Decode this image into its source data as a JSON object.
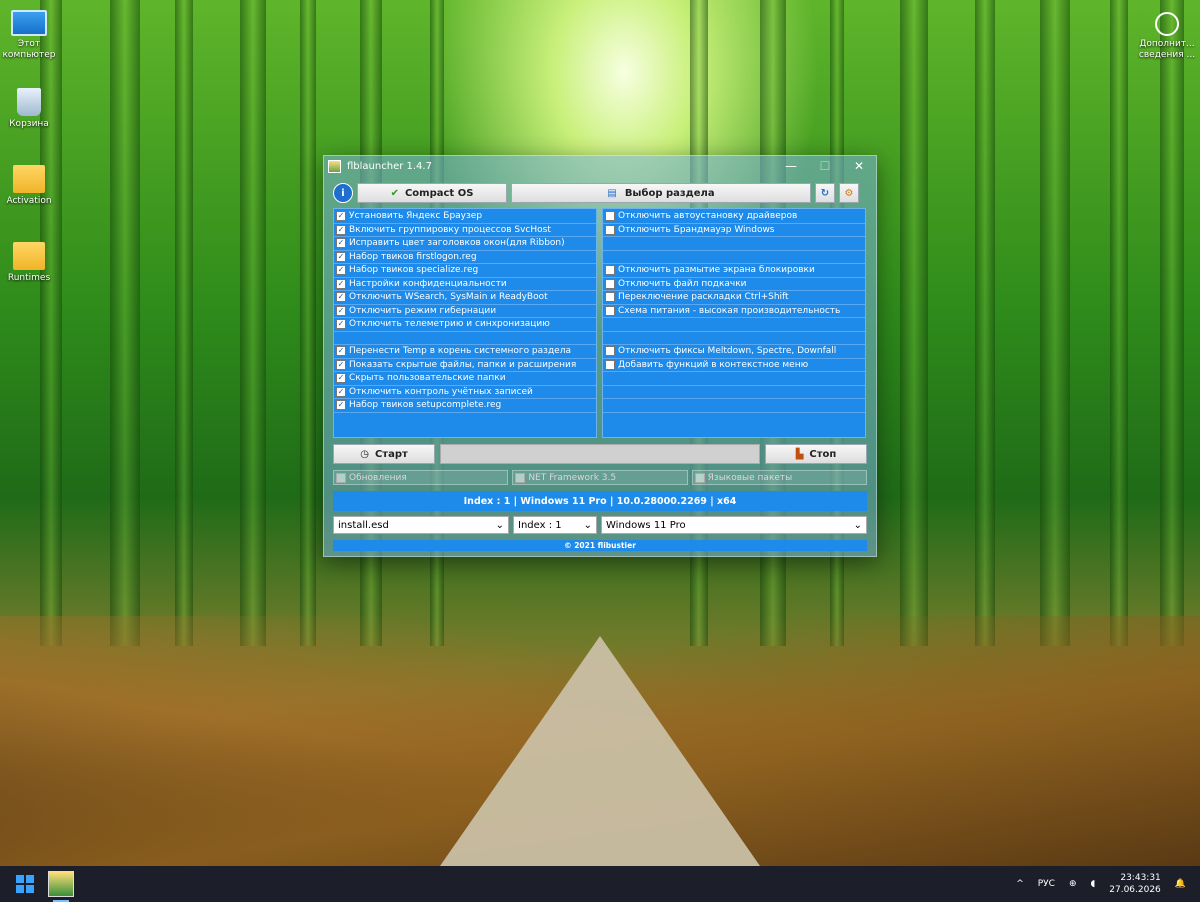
{
  "desktop": {
    "icons": [
      {
        "label": "Этот компьютер",
        "icon": "computer-icon"
      },
      {
        "label": "Корзина",
        "icon": "recycle-bin-icon"
      },
      {
        "label": "Activation",
        "icon": "folder-icon"
      },
      {
        "label": "Runtimes",
        "icon": "folder-icon"
      }
    ],
    "right_icon": {
      "label": "Дополнит... сведения ...",
      "icon": "info-icon"
    }
  },
  "window": {
    "title": "flblauncher 1.4.7",
    "controls": {
      "minimize": "—",
      "maximize": "☐",
      "close": "✕"
    },
    "toolbar": {
      "info_icon": "i",
      "compact_label": "Compact OS",
      "partition_label": "Выбор раздела",
      "refresh_icon": "↻",
      "settings_icon": "⚙"
    },
    "left_options": [
      {
        "label": "Установить Яндекс Браузер",
        "checked": true
      },
      {
        "label": "Включить группировку процессов SvcHost",
        "checked": true
      },
      {
        "label": "Исправить цвет заголовков окон(для Ribbon)",
        "checked": true
      },
      {
        "label": "Набор твиков firstlogon.reg",
        "checked": true
      },
      {
        "label": "Набор твиков specialize.reg",
        "checked": true
      },
      {
        "label": "Настройки конфиденциальности",
        "checked": true
      },
      {
        "label": "Отключить WSearch, SysMain и ReadyBoot",
        "checked": true
      },
      {
        "label": "Отключить режим гибернации",
        "checked": true
      },
      {
        "label": "Отключить телеметрию и синхронизацию",
        "checked": true
      },
      {
        "label": "",
        "checked": null
      },
      {
        "label": "Перенести Temp в корень системного раздела",
        "checked": true
      },
      {
        "label": "Показать скрытые файлы, папки и расширения",
        "checked": true
      },
      {
        "label": "Скрыть пользовательские папки",
        "checked": true
      },
      {
        "label": "Отключить контроль учётных записей",
        "checked": true
      },
      {
        "label": "Набор твиков setupcomplete.reg",
        "checked": true
      }
    ],
    "right_options": [
      {
        "label": "Отключить автоустановку драйверов",
        "checked": false
      },
      {
        "label": "Отключить Брандмауэр Windows",
        "checked": false
      },
      {
        "label": "",
        "checked": null
      },
      {
        "label": "",
        "checked": null
      },
      {
        "label": "Отключить размытие экрана блокировки",
        "checked": false
      },
      {
        "label": "Отключить файл подкачки",
        "checked": false
      },
      {
        "label": "Переключение раскладки Ctrl+Shift",
        "checked": false
      },
      {
        "label": "Схема питания - высокая производительность",
        "checked": false
      },
      {
        "label": "",
        "checked": null
      },
      {
        "label": "",
        "checked": null
      },
      {
        "label": "Отключить фиксы Meltdown, Spectre, Downfall",
        "checked": false
      },
      {
        "label": "Добавить функций в контекстное меню",
        "checked": false
      },
      {
        "label": "",
        "checked": null
      },
      {
        "label": "",
        "checked": null
      },
      {
        "label": "",
        "checked": null
      }
    ],
    "start_label": "Старт",
    "stop_label": "Стоп",
    "disabled_options": [
      "Обновления",
      "NET Framework 3.5",
      "Языковые пакеты"
    ],
    "info_text": "Index : 1 | Windows 11 Pro | 10.0.28000.2269 | x64",
    "selects": {
      "file": "install.esd",
      "index": "Index : 1",
      "edition": "Windows 11 Pro"
    },
    "footer": "© 2021 flibustier",
    "colors": {
      "panel": "#1e8aea",
      "window": "#78afdc"
    }
  },
  "taskbar": {
    "tray_chevron": "^",
    "language": "РУС",
    "time": "23:43:31",
    "date": "27.06.2026"
  }
}
